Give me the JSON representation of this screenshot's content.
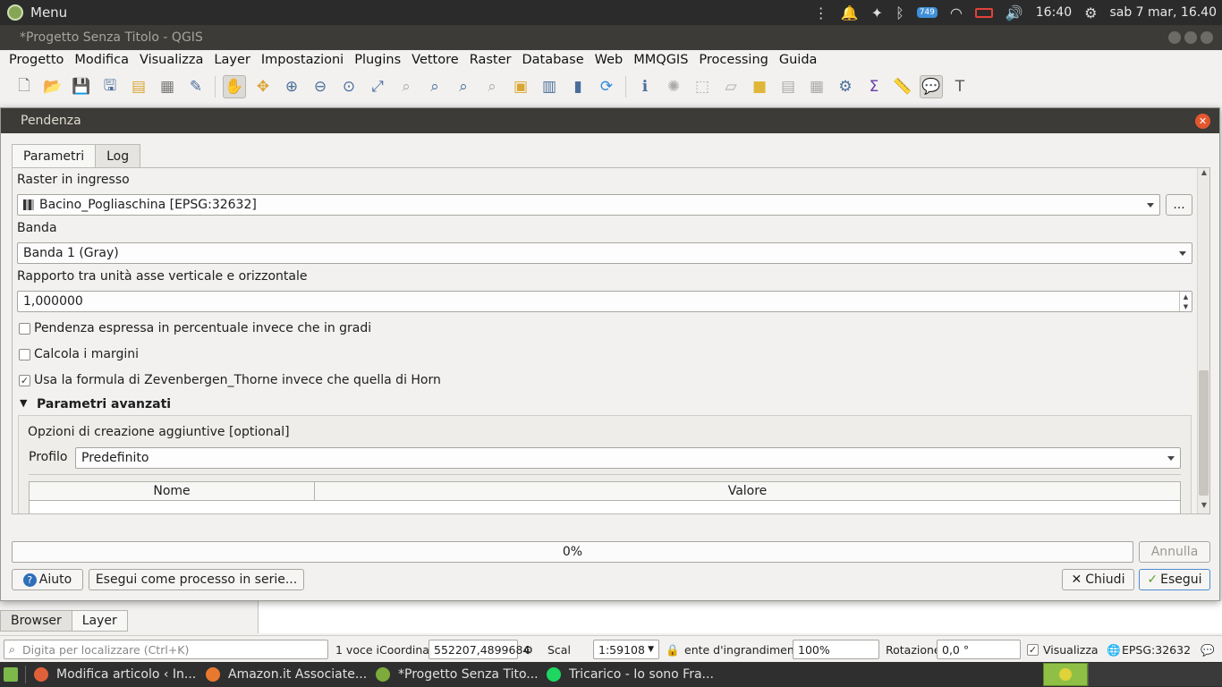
{
  "topbar": {
    "menu_label": "Menu",
    "badge": "749",
    "time": "16:40",
    "datetime": "sab 7 mar, 16.40"
  },
  "window": {
    "title": "*Progetto Senza Titolo - QGIS"
  },
  "menubar": [
    "Progetto",
    "Modifica",
    "Visualizza",
    "Layer",
    "Impostazioni",
    "Plugins",
    "Vettore",
    "Raster",
    "Database",
    "Web",
    "MMQGIS",
    "Processing",
    "Guida"
  ],
  "dialog": {
    "title": "Pendenza",
    "close_glyph": "✕",
    "tabs": {
      "params": "Parametri",
      "log": "Log"
    },
    "raster_label": "Raster in ingresso",
    "raster_value": "Bacino_Pogliaschina [EPSG:32632]",
    "browse_button": "...",
    "band_label": "Banda",
    "band_value": "Banda 1 (Gray)",
    "ratio_label": "Rapporto tra unità asse verticale e orizzontale",
    "ratio_value": "1,000000",
    "check1_label": "Pendenza espressa in percentuale invece che in gradi",
    "check1_checked": false,
    "check2_label": "Calcola i margini",
    "check2_checked": false,
    "check3_label": "Usa la formula di Zevenbergen_Thorne invece che quella di Horn",
    "check3_checked": true,
    "advanced_label": "Parametri avanzati",
    "creation_options_label": "Opzioni di creazione aggiuntive [optional]",
    "profile_label": "Profilo",
    "profile_value": "Predefinito",
    "table_col_name": "Nome",
    "table_col_value": "Valore",
    "progress": 0,
    "progress_text": "0%",
    "cancel_button": "Annulla",
    "help_button": "Aiuto",
    "batch_button": "Esegui come processo in serie...",
    "close_button": "Chiudi",
    "run_button": "Esegui"
  },
  "dock_tabs": {
    "browser": "Browser",
    "layer": "Layer"
  },
  "statusbar": {
    "locator_placeholder": "Digita per localizzare (Ctrl+K)",
    "layers_count": "1 voce i",
    "coord_label": "Coordinat",
    "coord_value": "552207,4899684",
    "scale_label": "Scal",
    "scale_value": "1:59108",
    "magnifier_label": "ente d'ingrandimento",
    "magnifier_value": "100%",
    "rotation_label": "Rotazione",
    "rotation_value": "0,0 °",
    "render_label": "Visualizza",
    "crs": "EPSG:32632"
  },
  "taskbar": [
    {
      "label": "Modifica articolo ‹ In...",
      "color": "#e0603a"
    },
    {
      "label": "Amazon.it Associate...",
      "color": "#e8792e"
    },
    {
      "label": "*Progetto Senza Tito...",
      "color": "#7dab3c"
    },
    {
      "label": "Tricarico - Io sono Fra...",
      "color": "#1ed760"
    }
  ]
}
